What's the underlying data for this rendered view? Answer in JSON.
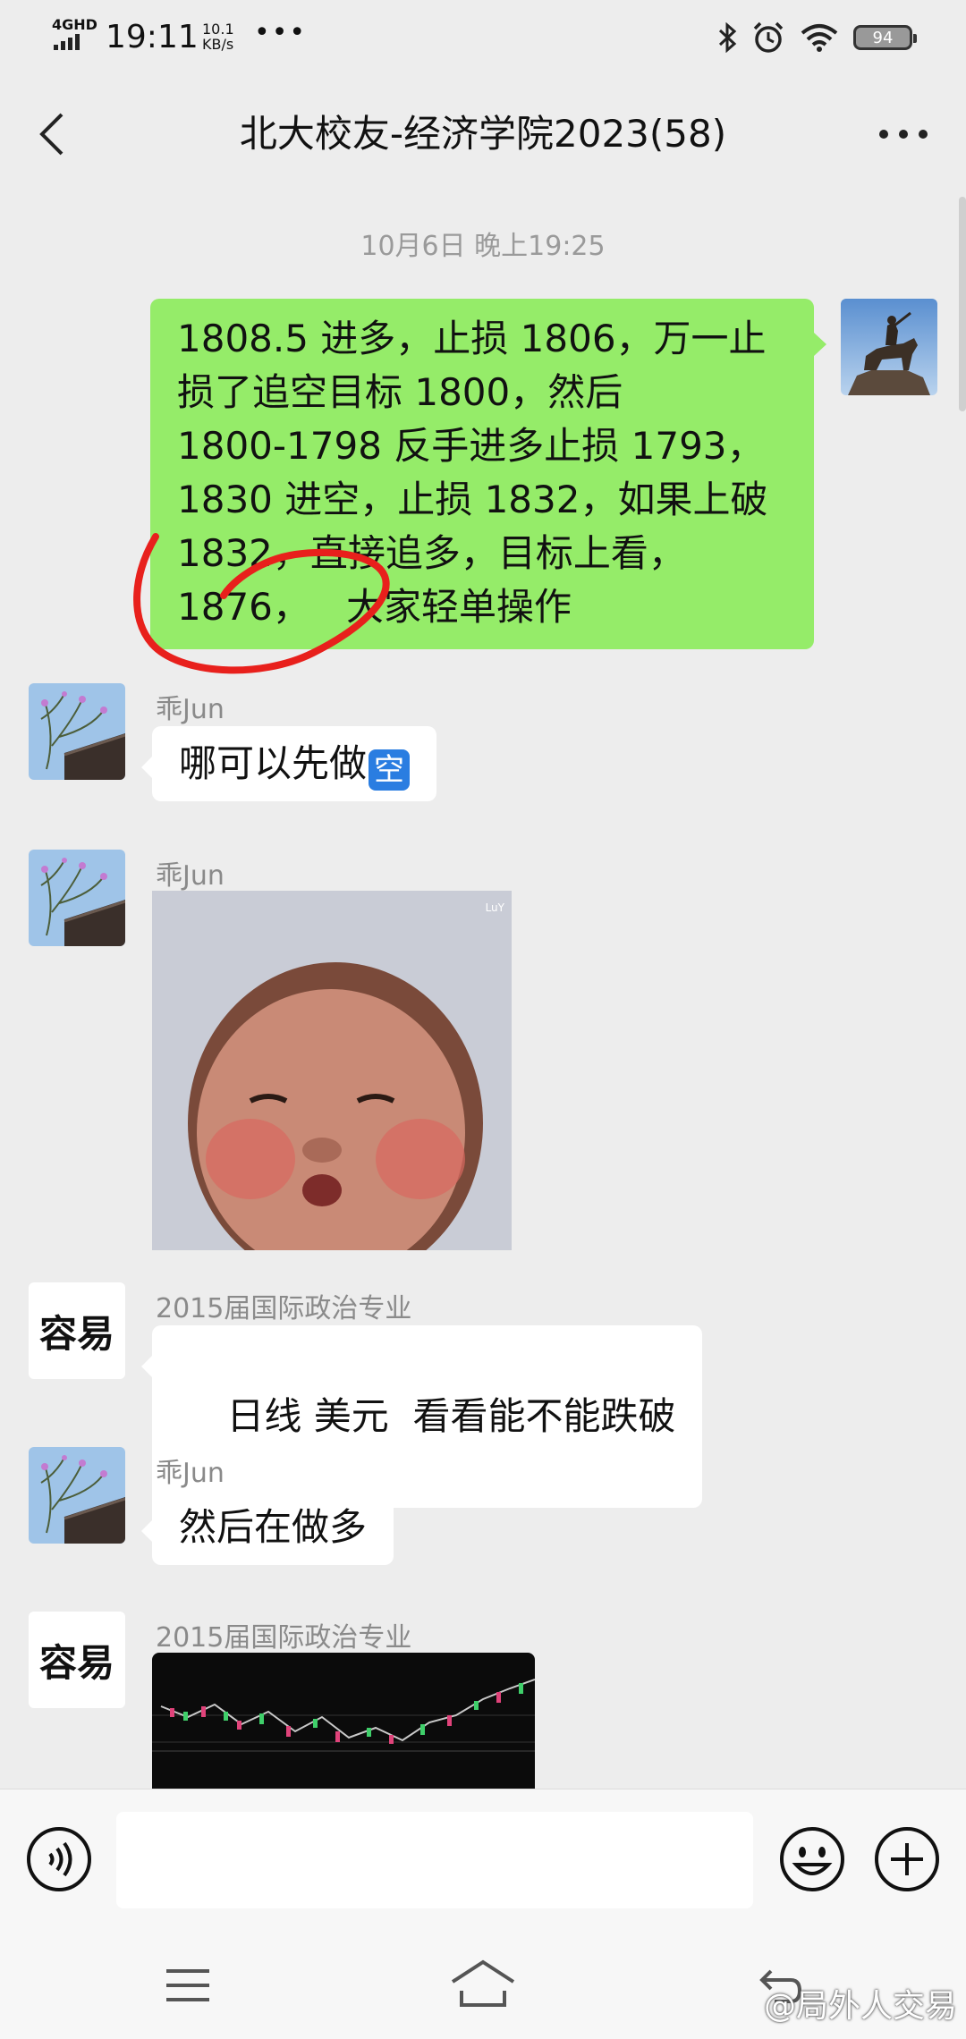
{
  "status_bar": {
    "network": "4GHD",
    "time": "19:11",
    "speed_value": "10.1",
    "speed_unit": "KB/s",
    "battery": "94"
  },
  "header": {
    "title": "北大校友-经济学院2023(58)"
  },
  "chat": {
    "timestamp": "10月6日 晚上19:25",
    "messages": [
      {
        "type": "text",
        "direction": "out",
        "lines": [
          "1808.5 进多，止损 1806，万一止",
          "损了追空目标 1800，然后",
          "1800-1798 反手进多止损 1793，",
          "1830 进空，止损 1832，如果上破",
          "1832，直接追多，目标上看，",
          "1876，   大家轻单操作"
        ]
      },
      {
        "type": "text",
        "direction": "in",
        "sender": "乖Jun",
        "text": "哪可以先做",
        "emoji": "空"
      },
      {
        "type": "image",
        "direction": "in",
        "sender": "乖Jun",
        "image_tag": "LuY"
      },
      {
        "type": "text",
        "direction": "in",
        "sender": "2015届国际政治专业",
        "avatar_text": "容易",
        "text": "日线 美元  看看能不能跌破"
      },
      {
        "type": "text",
        "direction": "in",
        "sender": "乖Jun",
        "text": "然后在做多"
      },
      {
        "type": "image",
        "direction": "in",
        "sender": "2015届国际政治专业",
        "avatar_text": "容易"
      }
    ]
  },
  "input_bar": {
    "placeholder": ""
  },
  "watermark": "@局外人交易",
  "colors": {
    "background": "#ededed",
    "outgoing_bubble": "#95ec69",
    "incoming_bubble": "#ffffff",
    "annotation_circle": "#e8201c"
  }
}
